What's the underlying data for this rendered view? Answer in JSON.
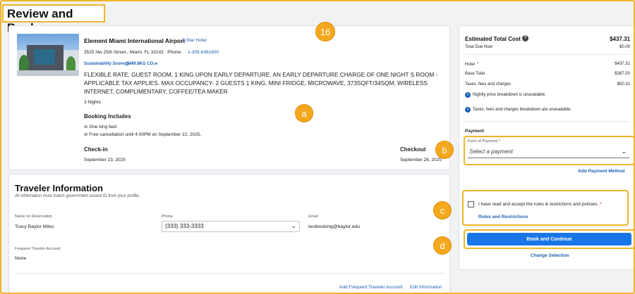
{
  "page": {
    "title": "Review and Book"
  },
  "hotel": {
    "name": "Element Miami International Airport",
    "star_rating": "3-Star Hotel",
    "address": "3525 Nw 25th Street., Miami, FL 33142",
    "phone_label": "Phone:",
    "phone": "1-305-6361600",
    "sustainability": "Sustainability Score: 56",
    "co2": "49.8KG CO₂e",
    "rate_description": "FLEXIBLE RATE, GUEST ROOM, 1 KING UPON EARLY DEPARTURE, AN EARLY DEPARTURE CHARGE OF ONE NIGHT S ROOM - APPLICABLE TAX APPLIES. MAX OCCUPANCY- 2 GUESTS 1 KING, MINI FRIDGE, MICROWAVE, 373SQFT/34SQM, WIRELESS INTERNET, COMPLIMENTARY, COFFEE/TEA MAKER",
    "nights": "3 Nights",
    "includes_heading": "Booking Includes",
    "includes": [
      "One king bed",
      "Free cancellation until 4:00PM on September 22, 2025."
    ],
    "checkin_label": "Check-in",
    "checkin_date": "September 23, 2025",
    "checkout_label": "Checkout",
    "checkout_date": "September 26, 2025"
  },
  "traveler": {
    "title": "Traveler Information",
    "note": "All information must match government issued ID from your profile.",
    "name_label": "Name on Reservation",
    "name_value": "Tracy Baylor Miles",
    "phone_label": "Phone",
    "phone_value": "(333) 333-3333",
    "email_label": "Email",
    "email_value": "testbooking@baylor.edu",
    "ffa_label": "Frequent Traveler Account",
    "ffa_value": "None",
    "add_ffa": "Add Frequent Traveler Account",
    "edit_info": "Edit Information"
  },
  "summary": {
    "title": "Estimated Total Cost",
    "total": "$437.31",
    "due_now_label": "Total Due Now",
    "due_now": "$0.00",
    "hotel_label": "Hotel",
    "hotel_amount": "$437.31",
    "base_label": "Base Total",
    "base_amount": "$387.00",
    "taxes_label": "Taxes, fees and charges",
    "taxes_amount": "$50.31",
    "info1": "Nightly price breakdown is unavailable.",
    "info2": "Taxes, fees and charges breakdown are unavailable.",
    "payment_heading": "Payment",
    "payment_field_label": "Form of Payment",
    "payment_placeholder": "Select a payment",
    "add_payment": "Add Payment Method",
    "terms_text": "I have read and accept the rules & restrictions and policies.",
    "rules_link": "Rules and Restrictions",
    "book_button": "Book and Continue",
    "change_selection": "Change Selection"
  },
  "badges": {
    "step": "16",
    "a": "a",
    "b": "b",
    "c": "c",
    "d": "d"
  },
  "colors": {
    "highlight": "#f0b429",
    "badge": "#f4a81d",
    "link": "#1a5fb4",
    "primary_button": "#1976e8"
  }
}
